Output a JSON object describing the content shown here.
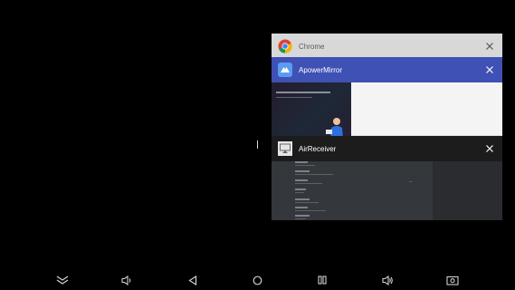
{
  "recents": {
    "cards": [
      {
        "title": "Chrome",
        "icon": "chrome-icon"
      },
      {
        "title": "ApowerMirror",
        "icon": "apowermirror-icon"
      },
      {
        "title": "AirReceiver",
        "icon": "airreceiver-icon"
      }
    ]
  },
  "navbar": {
    "buttons": [
      {
        "icon": "collapse-chevron-icon"
      },
      {
        "icon": "volume-down-icon"
      },
      {
        "icon": "back-icon"
      },
      {
        "icon": "home-icon"
      },
      {
        "icon": "recents-icon"
      },
      {
        "icon": "volume-up-icon"
      },
      {
        "icon": "screenshot-icon"
      }
    ]
  },
  "colors": {
    "background": "#000000",
    "apowermirror_header": "#3f51b5",
    "chrome_card": "#d8d8d8",
    "airreceiver_header": "#1c1c1c"
  }
}
